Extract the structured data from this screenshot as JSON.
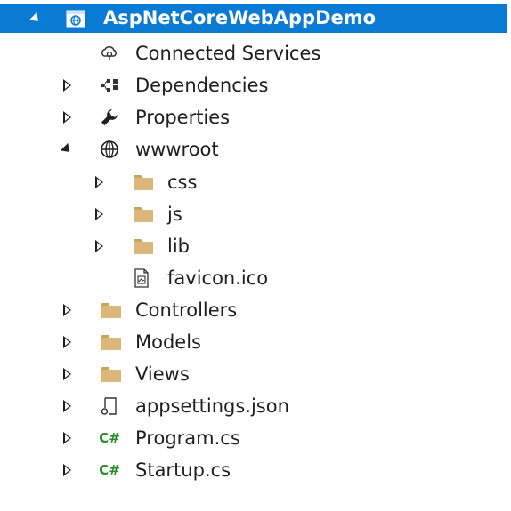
{
  "solution_explorer": {
    "project": {
      "label": "AspNetCoreWebAppDemo",
      "icon": "web-project-icon"
    },
    "items": [
      {
        "label": "Connected Services",
        "icon": "connected-services-icon"
      },
      {
        "label": "Dependencies",
        "icon": "dependencies-icon"
      },
      {
        "label": "Properties",
        "icon": "wrench-icon"
      },
      {
        "label": "wwwroot",
        "icon": "globe-icon"
      },
      {
        "label": "css",
        "icon": "folder-icon"
      },
      {
        "label": "js",
        "icon": "folder-icon"
      },
      {
        "label": "lib",
        "icon": "folder-icon"
      },
      {
        "label": "favicon.ico",
        "icon": "image-file-icon"
      },
      {
        "label": "Controllers",
        "icon": "folder-icon"
      },
      {
        "label": "Models",
        "icon": "folder-icon"
      },
      {
        "label": "Views",
        "icon": "folder-icon"
      },
      {
        "label": "appsettings.json",
        "icon": "json-file-icon"
      },
      {
        "label": "Program.cs",
        "icon": "csharp-file-icon"
      },
      {
        "label": "Startup.cs",
        "icon": "csharp-file-icon"
      }
    ],
    "csharp_glyph": "C#"
  },
  "colors": {
    "selection": "#0a7bd4",
    "folder": "#dcb67a",
    "csharp": "#2c8a2c"
  }
}
